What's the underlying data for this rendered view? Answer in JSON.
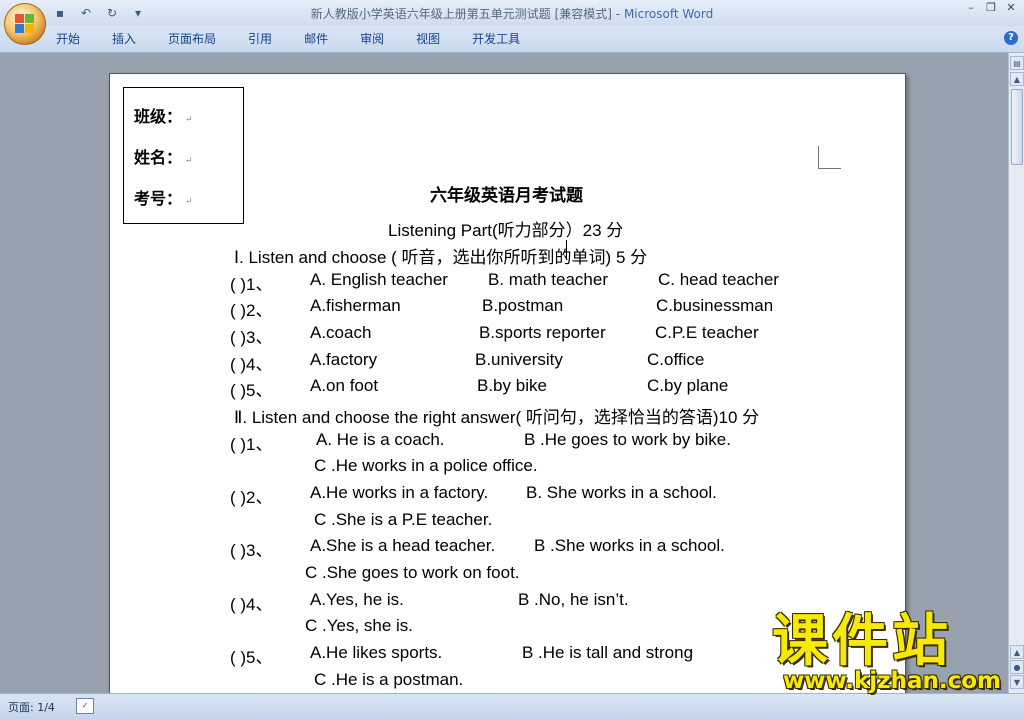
{
  "window": {
    "title": "新人教版小学英语六年级上册第五单元测试题 [兼容模式]",
    "app_name": "Microsoft Word",
    "title_separator": " - "
  },
  "ribbon": {
    "tabs": [
      "开始",
      "插入",
      "页面布局",
      "引用",
      "邮件",
      "审阅",
      "视图",
      "开发工具"
    ]
  },
  "status": {
    "page": "页面: 1/4"
  },
  "document": {
    "info": [
      "班级：",
      "姓名：",
      "考号："
    ],
    "exam_title": "六年级英语月考试题",
    "part_title": "Listening Part(听力部分）23 分",
    "section1": "Ⅰ. Listen and choose ( 听音，选出你所听到的单词) 5 分",
    "section1_items": [
      {
        "num": "(        )1、",
        "a": "A. English teacher",
        "b": "B. math teacher",
        "c": "C. head teacher"
      },
      {
        "num": "(        )2、",
        "a": "A.fisherman",
        "b": "B.postman",
        "c": "C.businessman"
      },
      {
        "num": "(        )3、",
        "a": "A.coach",
        "b": "B.sports reporter",
        "c": "C.P.E teacher"
      },
      {
        "num": "(        )4、",
        "a": "A.factory",
        "b": "B.university",
        "c": "C.office"
      },
      {
        "num": "(        )5、",
        "a": "A.on foot",
        "b": "B.by bike",
        "c": "C.by plane"
      }
    ],
    "section2": "Ⅱ. Listen and choose the right answer( 听问句，选择恰当的答语)10 分",
    "section2_items": [
      {
        "num": "(        )1、",
        "a": "A. He is a coach.",
        "b": "B .He goes to work by bike.",
        "c": "C .He works in a police office."
      },
      {
        "num": "(        )2、",
        "a": "A.He works in a factory.",
        "b": "B. She works in a school.",
        "c": "C .She is a P.E teacher."
      },
      {
        "num": "(        )3、",
        "a": "A.She is a head teacher.",
        "b": "B .She works in a school.",
        "c": "C .She goes to work on foot."
      },
      {
        "num": "(        )4、",
        "a": "A.Yes, he is.",
        "b": "B .No, he isn’t.",
        "c": "C .Yes, she is."
      },
      {
        "num": "(        )5、",
        "a": "A.He likes sports.",
        "b": "B .He is tall and strong",
        "c": "C .He is a postman."
      }
    ]
  },
  "watermark": {
    "brand": "课件站",
    "url": "www.kjzhan.com"
  }
}
